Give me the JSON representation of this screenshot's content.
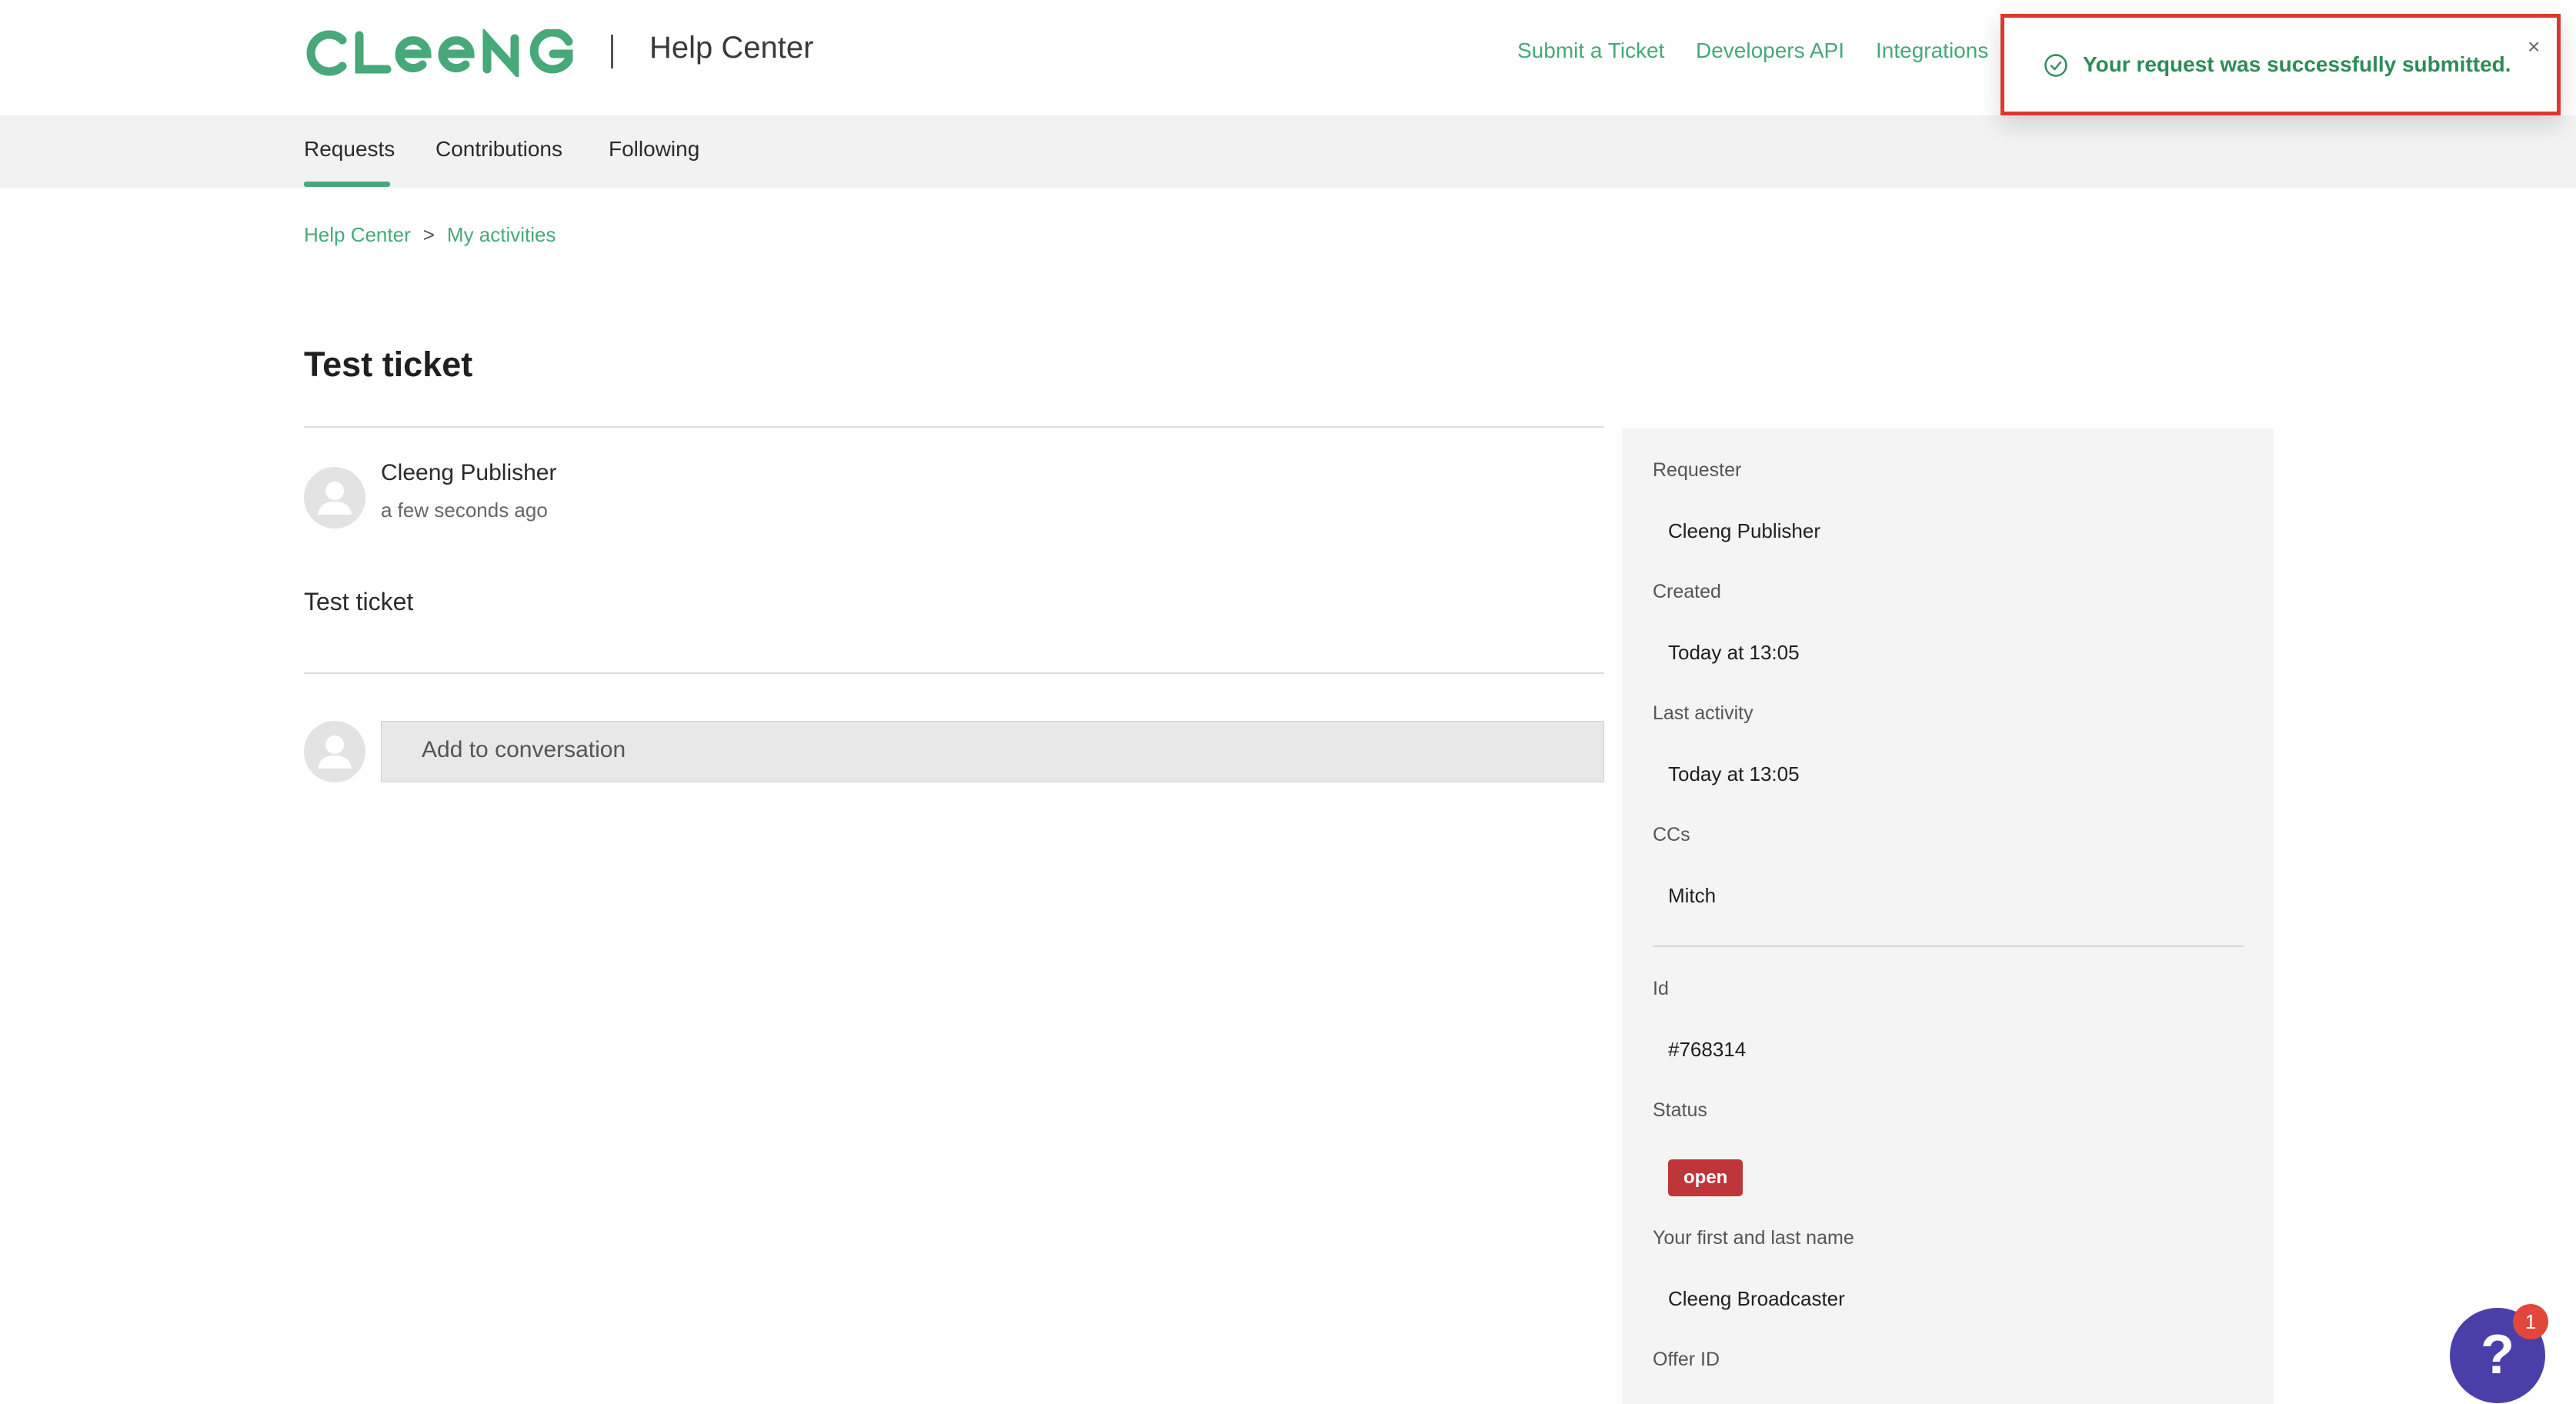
{
  "brand": {
    "logo_text": "CLEENG",
    "section_title": "Help Center",
    "accent_color": "#47a87a"
  },
  "top_nav": {
    "items": [
      {
        "label": "Submit a Ticket"
      },
      {
        "label": "Developers API"
      },
      {
        "label": "Integrations"
      }
    ]
  },
  "subnav": {
    "tabs": [
      {
        "label": "Requests",
        "active": true
      },
      {
        "label": "Contributions",
        "active": false
      },
      {
        "label": "Following",
        "active": false
      }
    ]
  },
  "breadcrumb": {
    "items": [
      "Help Center",
      "My activities"
    ],
    "separator": ">"
  },
  "ticket": {
    "title": "Test ticket",
    "comment": {
      "author": "Cleeng Publisher",
      "time": "a few seconds ago",
      "body": "Test ticket"
    },
    "reply_placeholder": "Add to conversation"
  },
  "sidebar": {
    "fields": [
      {
        "label": "Requester",
        "value": "Cleeng Publisher"
      },
      {
        "label": "Created",
        "value": "Today at 13:05"
      },
      {
        "label": "Last activity",
        "value": "Today at 13:05"
      },
      {
        "label": "CCs",
        "value": "Mitch"
      },
      {
        "label": "Id",
        "value": "#768314"
      },
      {
        "label": "Status",
        "value": "open"
      },
      {
        "label": "Your first and last name",
        "value": "Cleeng Broadcaster"
      },
      {
        "label": "Offer ID",
        "value": ""
      }
    ],
    "status_color": "#c0353a"
  },
  "toast": {
    "message": "Your request was successfully submitted.",
    "close_glyph": "×",
    "icon": "check-circle-icon"
  },
  "help_widget": {
    "glyph": "?",
    "badge_count": "1"
  }
}
